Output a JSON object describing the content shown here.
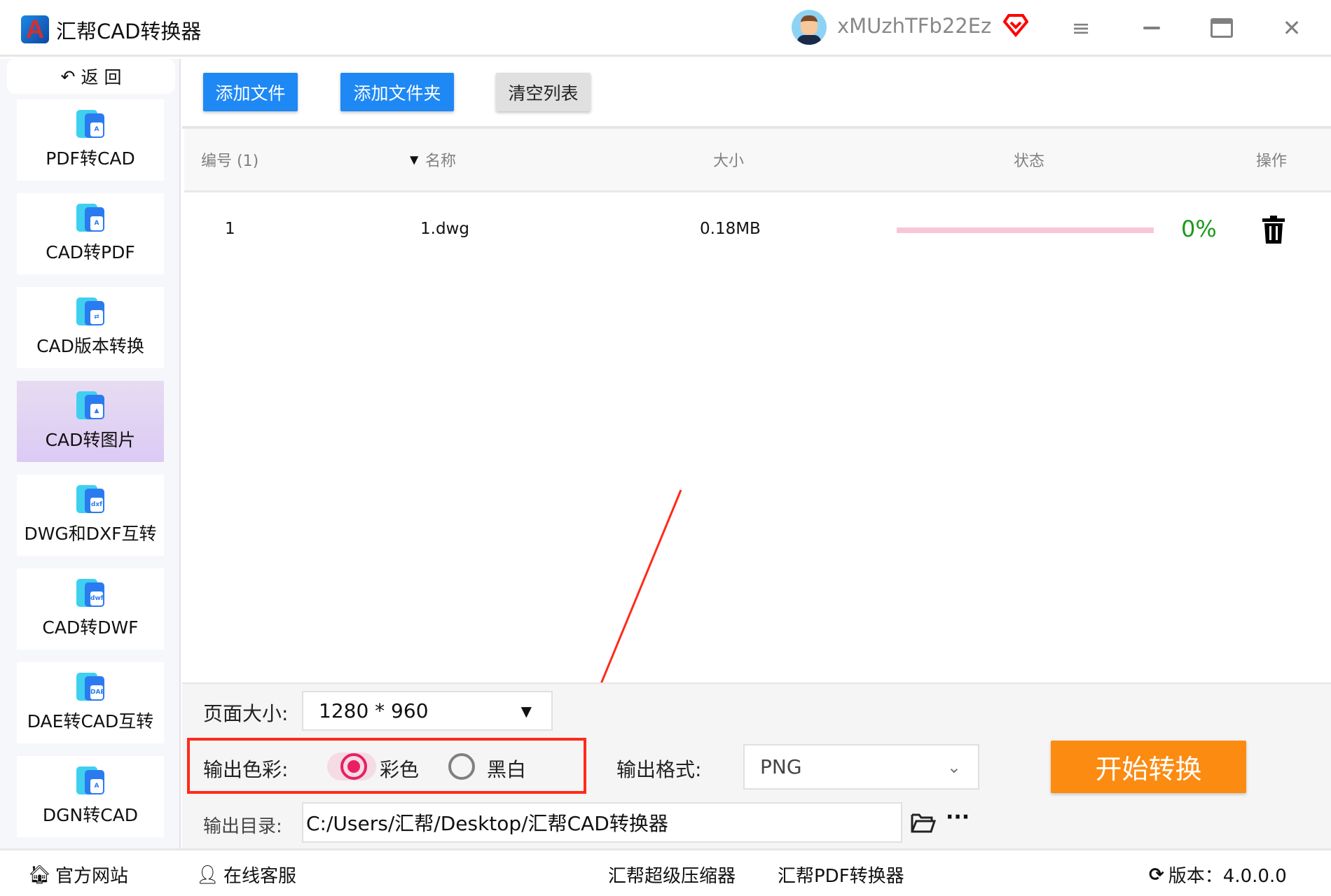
{
  "app": {
    "title": "汇帮CAD转换器",
    "username": "xMUzhTFb22Ez",
    "icons": {
      "logo": "autocad-a-logo",
      "vip": "diamond-vip-icon",
      "menu": "hamburger-icon",
      "minimize": "minimize-icon",
      "maximize": "maximize-icon",
      "close": "close-icon"
    }
  },
  "sidebar": {
    "back_label": "返 回",
    "active_index": 3,
    "items": [
      {
        "label": "PDF转CAD",
        "badge": "A"
      },
      {
        "label": "CAD转PDF",
        "badge": "A"
      },
      {
        "label": "CAD版本转换",
        "badge": "⇄"
      },
      {
        "label": "CAD转图片",
        "badge": "▲"
      },
      {
        "label": "DWG和DXF互转",
        "badge": "dxf"
      },
      {
        "label": "CAD转DWF",
        "badge": "dwf"
      },
      {
        "label": "DAE转CAD互转",
        "badge": "DAE"
      },
      {
        "label": "DGN转CAD",
        "badge": "A"
      }
    ]
  },
  "toolbar": {
    "add_file": "添加文件",
    "add_folder": "添加文件夹",
    "clear_list": "清空列表"
  },
  "table": {
    "columns": {
      "index": "编号 (1)",
      "name": "名称",
      "size": "大小",
      "status": "状态",
      "action": "操作"
    },
    "rows": [
      {
        "index": "1",
        "name": "1.dwg",
        "size": "0.18MB",
        "progress": 0,
        "progress_text": "0%"
      }
    ]
  },
  "settings": {
    "page_size_label": "页面大小:",
    "page_size_value": "1280 * 960",
    "color_label": "输出色彩:",
    "color_options": [
      "彩色",
      "黑白"
    ],
    "color_selected": "彩色",
    "format_label": "输出格式:",
    "format_value": "PNG",
    "dir_label": "输出目录:",
    "dir_value": "C:/Users/汇帮/Desktop/汇帮CAD转换器",
    "start_label": "开始转换"
  },
  "footer": {
    "website": "官方网站",
    "support": "在线客服",
    "compressor": "汇帮超级压缩器",
    "pdf_converter": "汇帮PDF转换器",
    "version": "版本：4.0.0.0"
  },
  "colors": {
    "accent_blue": "#1e88f5",
    "start_orange": "#fc8b12",
    "highlight_red": "#ff2a1a",
    "radio_pink": "#e91e63",
    "progress_green": "#1a9a1a",
    "active_item": "#dccaf4"
  }
}
